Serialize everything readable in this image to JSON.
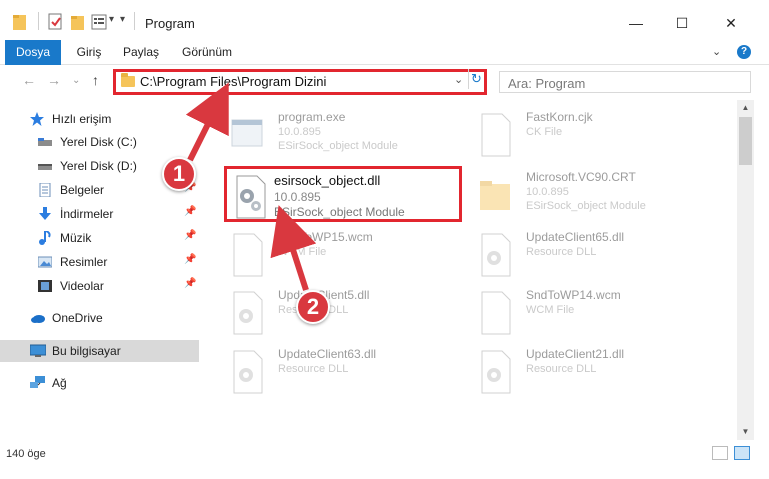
{
  "window": {
    "title": "Program",
    "minimize_glyph": "—",
    "maximize_glyph": "☐",
    "close_glyph": "✕"
  },
  "ribbon": {
    "tabs": [
      {
        "label": "Dosya"
      },
      {
        "label": "Giriş"
      },
      {
        "label": "Paylaş"
      },
      {
        "label": "Görünüm"
      }
    ],
    "expand_glyph": "⌄",
    "help_glyph": "?"
  },
  "navigation": {
    "back_glyph": "←",
    "forward_glyph": "→",
    "history_glyph": "⌄",
    "up_glyph": "↑"
  },
  "address": {
    "path": "C:\\Program Files\\Program Dizini",
    "dropdown_glyph": "⌄",
    "refresh_glyph": "↻"
  },
  "search": {
    "placeholder": "Ara: Program"
  },
  "sidebar": {
    "items": [
      {
        "label": "Hızlı erişim",
        "icon": "star-icon"
      },
      {
        "label": "Yerel Disk (C:)",
        "icon": "drive-icon",
        "pinned": true
      },
      {
        "label": "Yerel Disk (D:)",
        "icon": "drive-icon",
        "pinned": true
      },
      {
        "label": "Belgeler",
        "icon": "documents-icon",
        "pinned": true
      },
      {
        "label": "İndirmeler",
        "icon": "download-icon",
        "pinned": true
      },
      {
        "label": "Müzik",
        "icon": "music-icon",
        "pinned": true
      },
      {
        "label": "Resimler",
        "icon": "pictures-icon",
        "pinned": true
      },
      {
        "label": "Videolar",
        "icon": "videos-icon",
        "pinned": true
      },
      {
        "label": "OneDrive",
        "icon": "cloud-icon"
      },
      {
        "label": "Bu bilgisayar",
        "icon": "computer-icon",
        "selected": true
      },
      {
        "label": "Ağ",
        "icon": "network-icon"
      }
    ],
    "pin_glyph": "📌"
  },
  "files": {
    "left": [
      {
        "name": "program.exe",
        "version": "10.0.895",
        "desc": "ESirSock_object Module"
      },
      {
        "name": "SndToWP15.wcm",
        "version": "",
        "desc": "WCM File"
      },
      {
        "name": "UpdateClient5.dll",
        "version": "",
        "desc": "Resource DLL"
      },
      {
        "name": "UpdateClient63.dll",
        "version": "",
        "desc": "Resource DLL"
      }
    ],
    "right": [
      {
        "name": "FastKorn.cjk",
        "version": "",
        "desc": "CK File"
      },
      {
        "name": "Microsoft.VC90.CRT",
        "version": "10.0.895",
        "desc": "ESirSock_object Module"
      },
      {
        "name": "UpdateClient65.dll",
        "version": "",
        "desc": "Resource DLL"
      },
      {
        "name": "SndToWP14.wcm",
        "version": "",
        "desc": "WCM File"
      },
      {
        "name": "UpdateClient21.dll",
        "version": "",
        "desc": "Resource DLL"
      }
    ],
    "highlighted": {
      "name": "esirsock_object.dll",
      "version": "10.0.895",
      "desc": "ESirSock_object Module"
    }
  },
  "callouts": [
    "1",
    "2"
  ],
  "statusbar": {
    "count": "140 öge"
  },
  "colors": {
    "accent": "#1979ca",
    "highlight_red": "#e2262f",
    "callout_red": "#d9383f"
  }
}
